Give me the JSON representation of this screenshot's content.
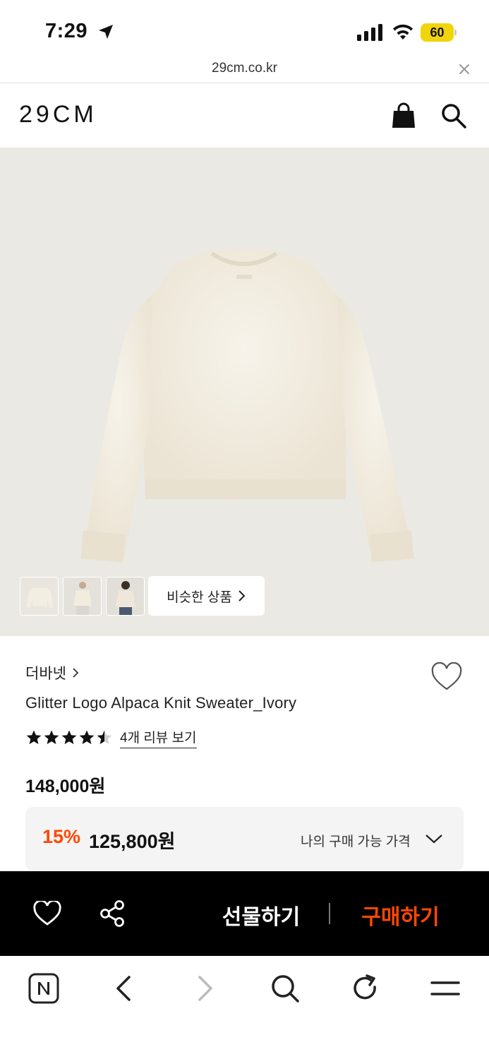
{
  "status": {
    "time": "7:29",
    "battery": "60"
  },
  "browser": {
    "url": "29cm.co.kr"
  },
  "header": {
    "logo": "29CM"
  },
  "gallery": {
    "similar_label": "비슷한 상품"
  },
  "product": {
    "brand": "더바넷",
    "name": "Glitter Logo Alpaca Knit Sweater_Ivory",
    "rating": 4.5,
    "rating_max": 5,
    "review_link": "4개 리뷰 보기",
    "original_price": "148,000원",
    "discount": "15%",
    "sale_price": "125,800원",
    "my_price_label": "나의 구매 가능 가격"
  },
  "actions": {
    "gift_label": "선물하기",
    "buy_label": "구매하기"
  },
  "colors": {
    "accent": "#ff4800",
    "sweater": "#f3eee2",
    "background": "#ebe9e4"
  }
}
